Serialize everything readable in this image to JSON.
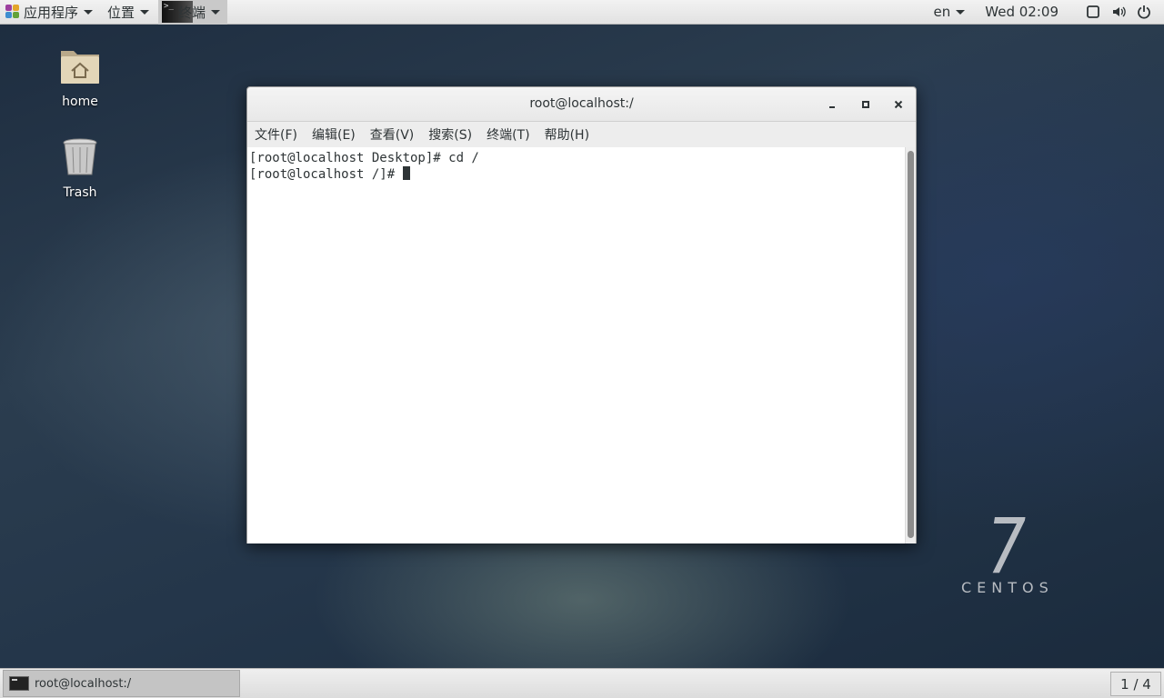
{
  "top_panel": {
    "applications_label": "应用程序",
    "places_label": "位置",
    "terminal_label": "终端",
    "terminal_thumb_text": ">_",
    "language": "en",
    "clock": "Wed 02:09"
  },
  "desktop": {
    "icons": [
      {
        "label": "home",
        "icon": "home-folder-icon"
      },
      {
        "label": "Trash",
        "icon": "trash-icon"
      }
    ]
  },
  "terminal_window": {
    "title": "root@localhost:/",
    "buttons": {
      "minimize": "_",
      "maximize": "□",
      "close": "✕"
    },
    "menu": [
      {
        "label": "文件(F)"
      },
      {
        "label": "编辑(E)"
      },
      {
        "label": "查看(V)"
      },
      {
        "label": "搜索(S)"
      },
      {
        "label": "终端(T)"
      },
      {
        "label": "帮助(H)"
      }
    ],
    "lines": [
      "[root@localhost Desktop]# cd /",
      "[root@localhost /]# "
    ]
  },
  "watermark": {
    "version": "7",
    "name": "CENTOS"
  },
  "bottom_panel": {
    "task_label": "root@localhost:/",
    "workspace": "1 / 4"
  }
}
